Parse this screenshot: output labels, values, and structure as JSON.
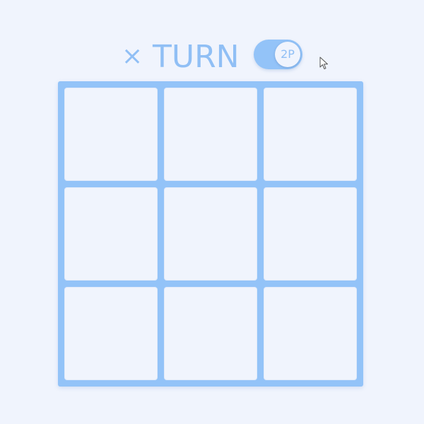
{
  "header": {
    "turn_mark": "×",
    "turn_label": "TURN",
    "mode_toggle": {
      "label": "2P",
      "state": "on"
    }
  },
  "board": {
    "cells": [
      "",
      "",
      "",
      "",
      "",
      "",
      "",
      "",
      ""
    ]
  },
  "colors": {
    "accent": "#93c3f8",
    "background": "#f0f4fd",
    "text": "#90bff5"
  }
}
